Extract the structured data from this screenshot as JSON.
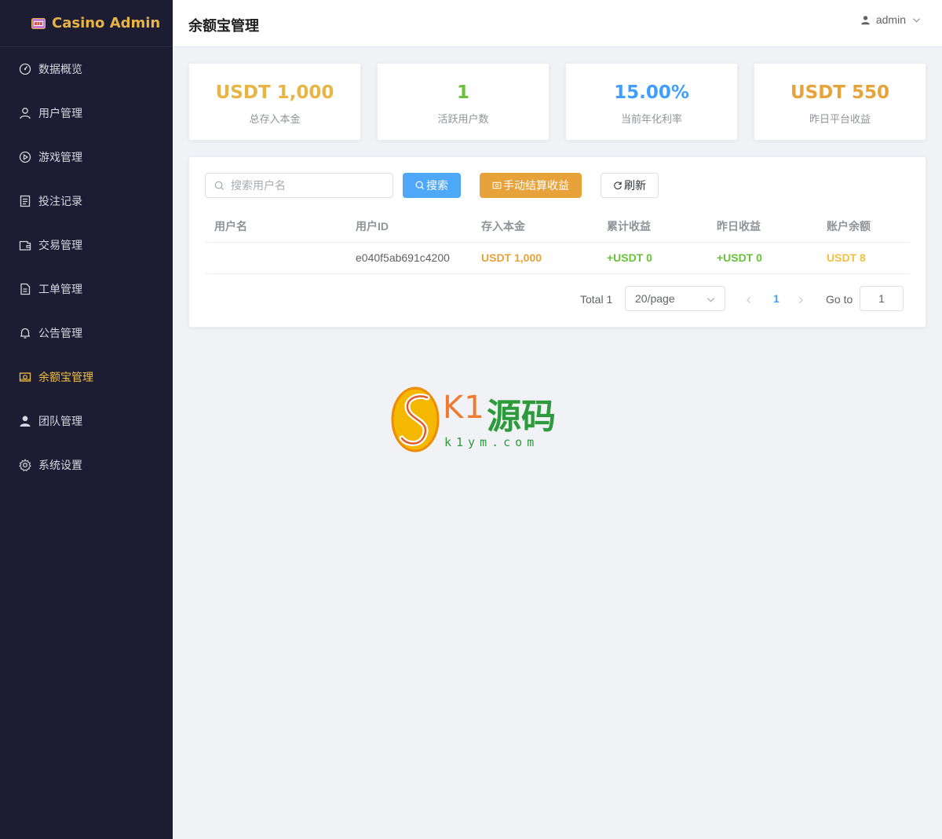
{
  "brand": {
    "name": "Casino Admin"
  },
  "sidebar": {
    "items": [
      {
        "label": "数据概览",
        "icon": "dashboard-icon",
        "active": false
      },
      {
        "label": "用户管理",
        "icon": "user-icon",
        "active": false
      },
      {
        "label": "游戏管理",
        "icon": "play-icon",
        "active": false
      },
      {
        "label": "投注记录",
        "icon": "document-icon",
        "active": false
      },
      {
        "label": "交易管理",
        "icon": "wallet-icon",
        "active": false
      },
      {
        "label": "工单管理",
        "icon": "ticket-icon",
        "active": false
      },
      {
        "label": "公告管理",
        "icon": "bell-icon",
        "active": false
      },
      {
        "label": "余额宝管理",
        "icon": "money-icon",
        "active": true
      },
      {
        "label": "团队管理",
        "icon": "team-icon",
        "active": false
      },
      {
        "label": "系统设置",
        "icon": "gear-icon",
        "active": false
      }
    ]
  },
  "header": {
    "title": "余额宝管理",
    "user": "admin"
  },
  "stats": [
    {
      "value": "USDT 1,000",
      "label": "总存入本金",
      "color": "#e8b443"
    },
    {
      "value": "1",
      "label": "活跃用户数",
      "color": "#67c23a"
    },
    {
      "value": "15.00%",
      "label": "当前年化利率",
      "color": "#409eff"
    },
    {
      "value": "USDT 550",
      "label": "昨日平台收益",
      "color": "#e8a23a"
    }
  ],
  "toolbar": {
    "search_placeholder": "搜索用户名",
    "search_label": "搜索",
    "settle_label": "手动结算收益",
    "refresh_label": "刷新"
  },
  "table": {
    "columns": [
      "用户名",
      "用户ID",
      "存入本金",
      "累计收益",
      "昨日收益",
      "账户余额"
    ],
    "rows": [
      {
        "username": "",
        "user_id": "e040f5ab691c4200",
        "principal": "USDT 1,000",
        "total_income": "+USDT 0",
        "yesterday_income": "+USDT 0",
        "balance": "USDT 8"
      }
    ]
  },
  "pagination": {
    "total_label": "Total 1",
    "page_size": "20/page",
    "current_page": "1",
    "goto_label": "Go to",
    "goto_value": "1"
  },
  "watermark": {
    "brand_latin": "K1",
    "brand_cn": "源码",
    "url": "k1ym.com"
  }
}
